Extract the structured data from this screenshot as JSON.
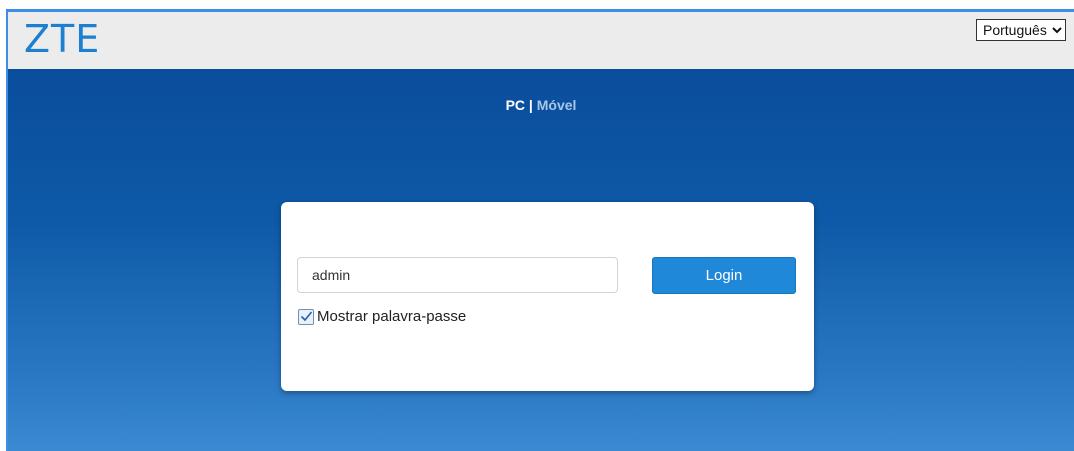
{
  "header": {
    "logo_text": "ZTE",
    "language": {
      "selected": "Português",
      "options": [
        "Português"
      ]
    }
  },
  "view_switcher": {
    "pc_label": "PC",
    "separator": "|",
    "mobile_label": "Móvel"
  },
  "login": {
    "password_value": "admin",
    "login_label": "Login",
    "show_password_label": "Mostrar palavra-passe",
    "show_password_checked": true
  },
  "colors": {
    "brand": "#1d7fd0",
    "button": "#1f88d8",
    "background_top": "#0a4d9c",
    "background_bottom": "#3b8ad2"
  }
}
